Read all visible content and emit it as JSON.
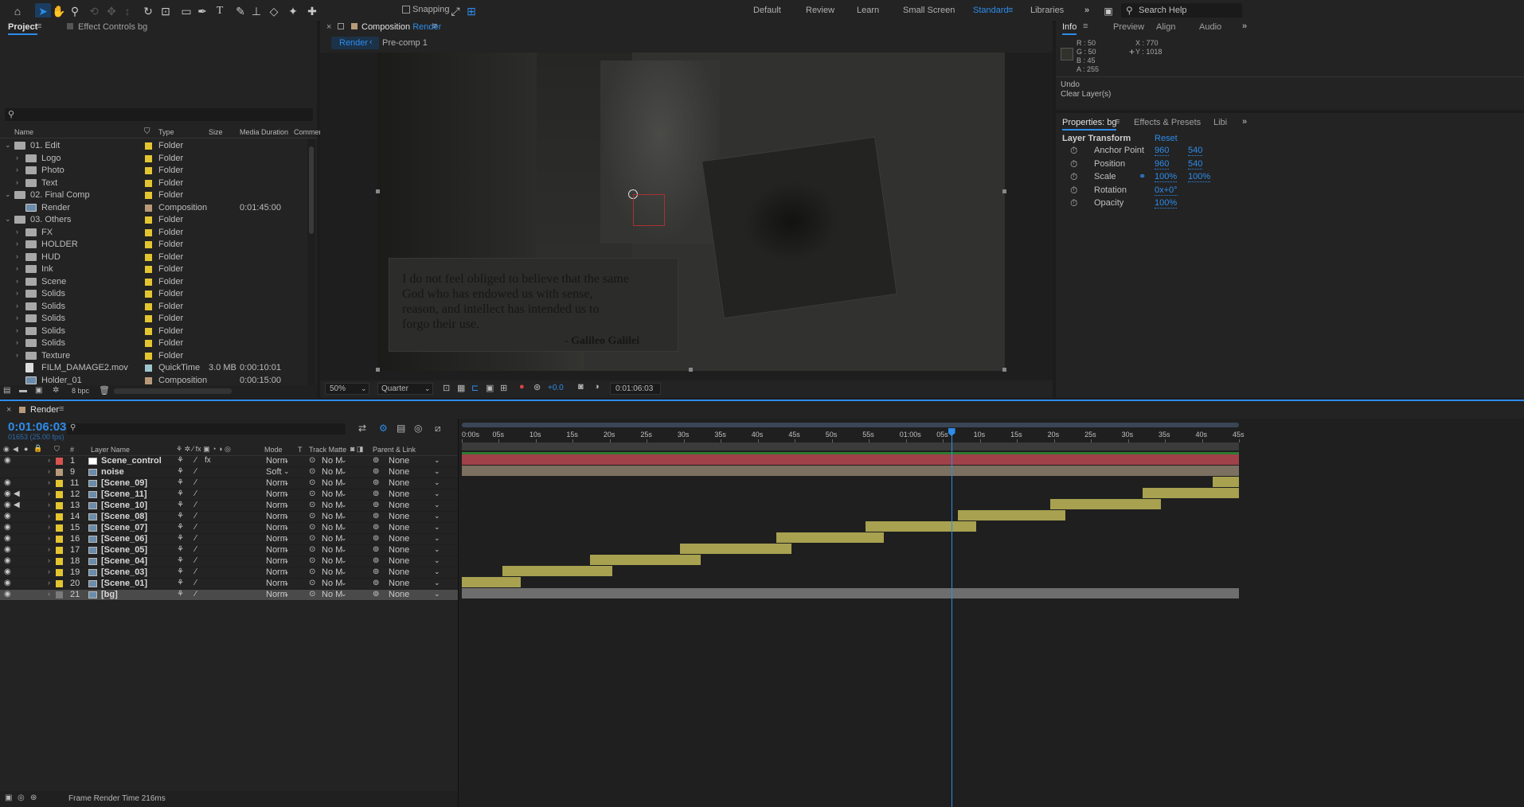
{
  "toolbar": {
    "snapping_label": "Snapping",
    "workspaces": [
      "Default",
      "Review",
      "Learn",
      "Small Screen",
      "Standard",
      "Libraries"
    ],
    "active_workspace": "Standard",
    "search_placeholder": "Search Help"
  },
  "project": {
    "tab": "Project",
    "tab2": "Effect Controls bg",
    "search": "",
    "columns": [
      "Name",
      "Type",
      "Size",
      "Media Duration",
      "Commer"
    ],
    "items": [
      {
        "name": "01. Edit",
        "type": "Folder",
        "size": "",
        "dur": "",
        "level": 0,
        "color": "#e3c531",
        "icon": "folder",
        "expanded": true
      },
      {
        "name": "Logo",
        "type": "Folder",
        "size": "",
        "dur": "",
        "level": 1,
        "color": "#e3c531",
        "icon": "folder"
      },
      {
        "name": "Photo",
        "type": "Folder",
        "size": "",
        "dur": "",
        "level": 1,
        "color": "#e3c531",
        "icon": "folder"
      },
      {
        "name": "Text",
        "type": "Folder",
        "size": "",
        "dur": "",
        "level": 1,
        "color": "#e3c531",
        "icon": "folder"
      },
      {
        "name": "02. Final Comp",
        "type": "Folder",
        "size": "",
        "dur": "",
        "level": 0,
        "color": "#e3c531",
        "icon": "folder",
        "expanded": true
      },
      {
        "name": "Render",
        "type": "Composition",
        "size": "",
        "dur": "0:01:45:00",
        "level": 1,
        "color": "#b89a7a",
        "icon": "comp",
        "noarrow": true
      },
      {
        "name": "03. Others",
        "type": "Folder",
        "size": "",
        "dur": "",
        "level": 0,
        "color": "#e3c531",
        "icon": "folder",
        "expanded": true
      },
      {
        "name": "FX",
        "type": "Folder",
        "size": "",
        "dur": "",
        "level": 1,
        "color": "#e3c531",
        "icon": "folder"
      },
      {
        "name": "HOLDER",
        "type": "Folder",
        "size": "",
        "dur": "",
        "level": 1,
        "color": "#e3c531",
        "icon": "folder"
      },
      {
        "name": "HUD",
        "type": "Folder",
        "size": "",
        "dur": "",
        "level": 1,
        "color": "#e3c531",
        "icon": "folder"
      },
      {
        "name": "Ink",
        "type": "Folder",
        "size": "",
        "dur": "",
        "level": 1,
        "color": "#e3c531",
        "icon": "folder"
      },
      {
        "name": "Scene",
        "type": "Folder",
        "size": "",
        "dur": "",
        "level": 1,
        "color": "#e3c531",
        "icon": "folder"
      },
      {
        "name": "Solids",
        "type": "Folder",
        "size": "",
        "dur": "",
        "level": 1,
        "color": "#e3c531",
        "icon": "folder"
      },
      {
        "name": "Solids",
        "type": "Folder",
        "size": "",
        "dur": "",
        "level": 1,
        "color": "#e3c531",
        "icon": "folder"
      },
      {
        "name": "Solids",
        "type": "Folder",
        "size": "",
        "dur": "",
        "level": 1,
        "color": "#e3c531",
        "icon": "folder"
      },
      {
        "name": "Solids",
        "type": "Folder",
        "size": "",
        "dur": "",
        "level": 1,
        "color": "#e3c531",
        "icon": "folder"
      },
      {
        "name": "Solids",
        "type": "Folder",
        "size": "",
        "dur": "",
        "level": 1,
        "color": "#e3c531",
        "icon": "folder"
      },
      {
        "name": "Texture",
        "type": "Folder",
        "size": "",
        "dur": "",
        "level": 1,
        "color": "#e3c531",
        "icon": "folder"
      },
      {
        "name": "FILM_DAMAGE2.mov",
        "type": "QuickTime",
        "size": "3.0 MB",
        "dur": "0:00:10:01",
        "level": 1,
        "color": "#9fc6cf",
        "icon": "file",
        "noarrow": true
      },
      {
        "name": "Holder_01",
        "type": "Composition",
        "size": "",
        "dur": "0:00:15:00",
        "level": 1,
        "color": "#b89a7a",
        "icon": "comp",
        "noarrow": true
      }
    ],
    "bpc": "8 bpc"
  },
  "comp": {
    "tab_prefix": "Composition",
    "tab_name": "Render",
    "breadcrumb": [
      "Render",
      "Pre-comp 1"
    ],
    "zoom": "50%",
    "resolution": "Quarter",
    "exposure": "+0.0",
    "timecode": "0:01:06:03",
    "quote_lines": [
      "I do not feel obliged to believe that the same",
      "God who has endowed us with sense,",
      "reason, and intellect has intended us to",
      "forgo their use."
    ],
    "quote_author": "- Galileo Galilei"
  },
  "info": {
    "tabs": [
      "Info",
      "Preview",
      "Align",
      "Audio"
    ],
    "r": "R : 50",
    "g": "G : 50",
    "b": "B : 45",
    "a": "A : 255",
    "x": "X : 770",
    "y": "Y : 1018",
    "undo": "Undo",
    "undo_action": "Clear Layer(s)"
  },
  "properties": {
    "tabs": [
      "Properties: bg",
      "Effects & Presets",
      "Libi"
    ],
    "section": "Layer Transform",
    "reset": "Reset",
    "rows": [
      {
        "label": "Anchor Point",
        "v1": "960",
        "v2": "540"
      },
      {
        "label": "Position",
        "v1": "960",
        "v2": "540"
      },
      {
        "label": "Scale",
        "v1": "100%",
        "v2": "100%"
      },
      {
        "label": "Rotation",
        "v1": "0x+0°",
        "v2": ""
      },
      {
        "label": "Opacity",
        "v1": "100%",
        "v2": ""
      }
    ]
  },
  "timeline": {
    "tab": "Render",
    "timecode": "0:01:06:03",
    "fps": "01653 (25.00 fps)",
    "search": "",
    "headers": {
      "num": "#",
      "layer_name": "Layer Name",
      "mode": "Mode",
      "t": "T",
      "track_matte": "Track Matte",
      "parent": "Parent & Link"
    },
    "ruler": [
      "0:00s",
      "05s",
      "10s",
      "15s",
      "20s",
      "25s",
      "30s",
      "35s",
      "40s",
      "45s",
      "50s",
      "55s",
      "01:00s",
      "05s",
      "10s",
      "15s",
      "20s",
      "25s",
      "30s",
      "35s",
      "40s",
      "45s"
    ],
    "playhead_seconds": 66.12,
    "duration_seconds": 105,
    "layers": [
      {
        "num": "1",
        "name": "Scene_control",
        "label": "#d9534f",
        "mode": "Norm",
        "matte": "No M",
        "parent": "None",
        "start": 0,
        "end": 105,
        "bar": "#a04048",
        "eye": true,
        "type": "solid",
        "fx": true
      },
      {
        "num": "9",
        "name": "noise",
        "label": "#b89a7a",
        "mode": "Soft",
        "matte": "No M",
        "parent": "None",
        "start": 0,
        "end": 105,
        "bar": "#7c7060",
        "eye": false,
        "type": "comp"
      },
      {
        "num": "11",
        "name": "[Scene_09]",
        "label": "#e3c531",
        "mode": "Norm",
        "matte": "No M",
        "parent": "None",
        "start": 101.5,
        "end": 105,
        "bar": "#a7a150",
        "eye": true,
        "type": "comp"
      },
      {
        "num": "12",
        "name": "[Scene_11]",
        "label": "#e3c531",
        "mode": "Norm",
        "matte": "No M",
        "parent": "None",
        "start": 92,
        "end": 105,
        "bar": "#a7a150",
        "eye": true,
        "audio": true,
        "type": "comp"
      },
      {
        "num": "13",
        "name": "[Scene_10]",
        "label": "#e3c531",
        "mode": "Norm",
        "matte": "No M",
        "parent": "None",
        "start": 79.5,
        "end": 94.5,
        "bar": "#a7a150",
        "eye": true,
        "audio": true,
        "type": "comp"
      },
      {
        "num": "14",
        "name": "[Scene_08]",
        "label": "#e3c531",
        "mode": "Norm",
        "matte": "No M",
        "parent": "None",
        "start": 67,
        "end": 81.5,
        "bar": "#a7a150",
        "eye": true,
        "type": "comp"
      },
      {
        "num": "15",
        "name": "[Scene_07]",
        "label": "#e3c531",
        "mode": "Norm",
        "matte": "No M",
        "parent": "None",
        "start": 54.5,
        "end": 69.5,
        "bar": "#a7a150",
        "eye": true,
        "type": "comp"
      },
      {
        "num": "16",
        "name": "[Scene_06]",
        "label": "#e3c531",
        "mode": "Norm",
        "matte": "No M",
        "parent": "None",
        "start": 42.5,
        "end": 57,
        "bar": "#a7a150",
        "eye": true,
        "type": "comp"
      },
      {
        "num": "17",
        "name": "[Scene_05]",
        "label": "#e3c531",
        "mode": "Norm",
        "matte": "No M",
        "parent": "None",
        "start": 29.5,
        "end": 44.5,
        "bar": "#a7a150",
        "eye": true,
        "type": "comp"
      },
      {
        "num": "18",
        "name": "[Scene_04]",
        "label": "#e3c531",
        "mode": "Norm",
        "matte": "No M",
        "parent": "None",
        "start": 17.3,
        "end": 32.3,
        "bar": "#a7a150",
        "eye": true,
        "type": "comp"
      },
      {
        "num": "19",
        "name": "[Scene_03]",
        "label": "#e3c531",
        "mode": "Norm",
        "matte": "No M",
        "parent": "None",
        "start": 5.5,
        "end": 20.3,
        "bar": "#a7a150",
        "eye": true,
        "type": "comp"
      },
      {
        "num": "20",
        "name": "[Scene_01]",
        "label": "#e3c531",
        "mode": "Norm",
        "matte": "No M",
        "parent": "None",
        "start": 0,
        "end": 8,
        "bar": "#a7a150",
        "eye": true,
        "type": "comp"
      },
      {
        "num": "21",
        "name": "[bg]",
        "label": "#7a7a7a",
        "mode": "Norm",
        "matte": "No M",
        "parent": "None",
        "start": 0,
        "end": 105,
        "bar": "#6e6e6e",
        "eye": true,
        "type": "comp",
        "selected": true
      }
    ],
    "footer": "Frame Render Time  216ms"
  },
  "colors": {
    "accent": "#2d8ceb",
    "label_yellow": "#e3c531"
  }
}
